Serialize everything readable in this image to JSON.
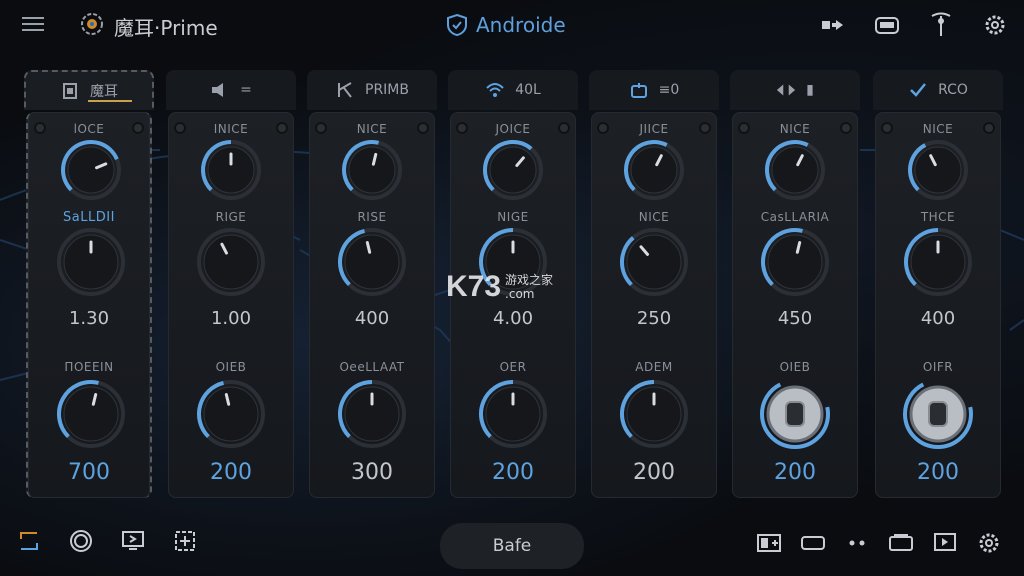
{
  "app": {
    "title": "魔耳·Prime",
    "center_title": "Androide"
  },
  "colors": {
    "accent": "#5ea3e0",
    "panel": "#1b1e23",
    "background": "#0b0d11"
  },
  "top_icons": [
    "bypass-icon",
    "amp-icon",
    "tuner-icon",
    "settings-icon"
  ],
  "strips": [
    {
      "header": "魔耳",
      "icon": "pedal-icon",
      "k1_label": "lOCE",
      "k1_level": 0.75,
      "k2_label": "SaLLDII",
      "k2_blue": true,
      "k2_level": 0.5,
      "val": "1.30",
      "k3_label": "ΠOEEΙΝ",
      "k3_level": 0.55,
      "big": "700",
      "big_blue": true,
      "footswitch": false
    },
    {
      "header": "=",
      "icon": "speaker-icon",
      "k1_label": "ΙΝΙCE",
      "k1_level": 0.5,
      "k2_label": "RIGE",
      "k2_blue": false,
      "k2_level": 0.4,
      "val": "1.00",
      "k3_label": "OΙEB",
      "k3_level": 0.45,
      "big": "200",
      "big_blue": true,
      "footswitch": false
    },
    {
      "header": "PRIMB",
      "icon": "scissors-icon",
      "k1_label": "ΝΙCE",
      "k1_level": 0.55,
      "k2_label": "RISE",
      "k2_blue": false,
      "k2_level": 0.45,
      "val": "400",
      "k3_label": "OeeLLAAT",
      "k3_level": 0.5,
      "big": "300",
      "big_blue": false,
      "footswitch": false
    },
    {
      "header": "40L",
      "icon": "wifi-icon",
      "k1_label": "JOICE",
      "k1_level": 0.65,
      "k2_label": "ΝIGE",
      "k2_blue": false,
      "k2_level": 0.5,
      "val": "4.00",
      "k3_label": "OΕR",
      "k3_level": 0.5,
      "big": "200",
      "big_blue": true,
      "footswitch": false
    },
    {
      "header": "≡0",
      "icon": "loop-icon",
      "k1_label": "JΙICE",
      "k1_level": 0.6,
      "k2_label": "ΝICE",
      "k2_blue": false,
      "k2_level": 0.35,
      "val": "250",
      "k3_label": "ADEM",
      "k3_level": 0.5,
      "big": "200",
      "big_blue": false,
      "footswitch": false
    },
    {
      "header": "▮",
      "icon": "arrows-icon",
      "k1_label": "ΝICE",
      "k1_level": 0.6,
      "k2_label": "CasLLARIA",
      "k2_blue": false,
      "k2_level": 0.55,
      "val": "450",
      "k3_label": "OΙEB",
      "k3_level": 0.0,
      "big": "200",
      "big_blue": true,
      "footswitch": true
    },
    {
      "header": "RCO",
      "icon": "check-icon",
      "k1_label": "ΝICE",
      "k1_level": 0.4,
      "k2_label": "THCE",
      "k2_blue": false,
      "k2_level": 0.5,
      "val": "400",
      "k3_label": "OΙFR",
      "k3_level": 0.0,
      "big": "200",
      "big_blue": true,
      "footswitch": true
    }
  ],
  "watermark": {
    "logo": "K73",
    "line1": "游戏之家",
    "line2": ".com"
  },
  "bottom": {
    "safe_label": "Bafe",
    "left_icons": [
      "sync-icon",
      "record-icon",
      "screen-icon",
      "add-square-icon"
    ],
    "right_icons": [
      "add-box-icon",
      "rectangle-icon",
      "dots-icon",
      "window-icon",
      "play-box-icon",
      "settings-icon"
    ]
  }
}
